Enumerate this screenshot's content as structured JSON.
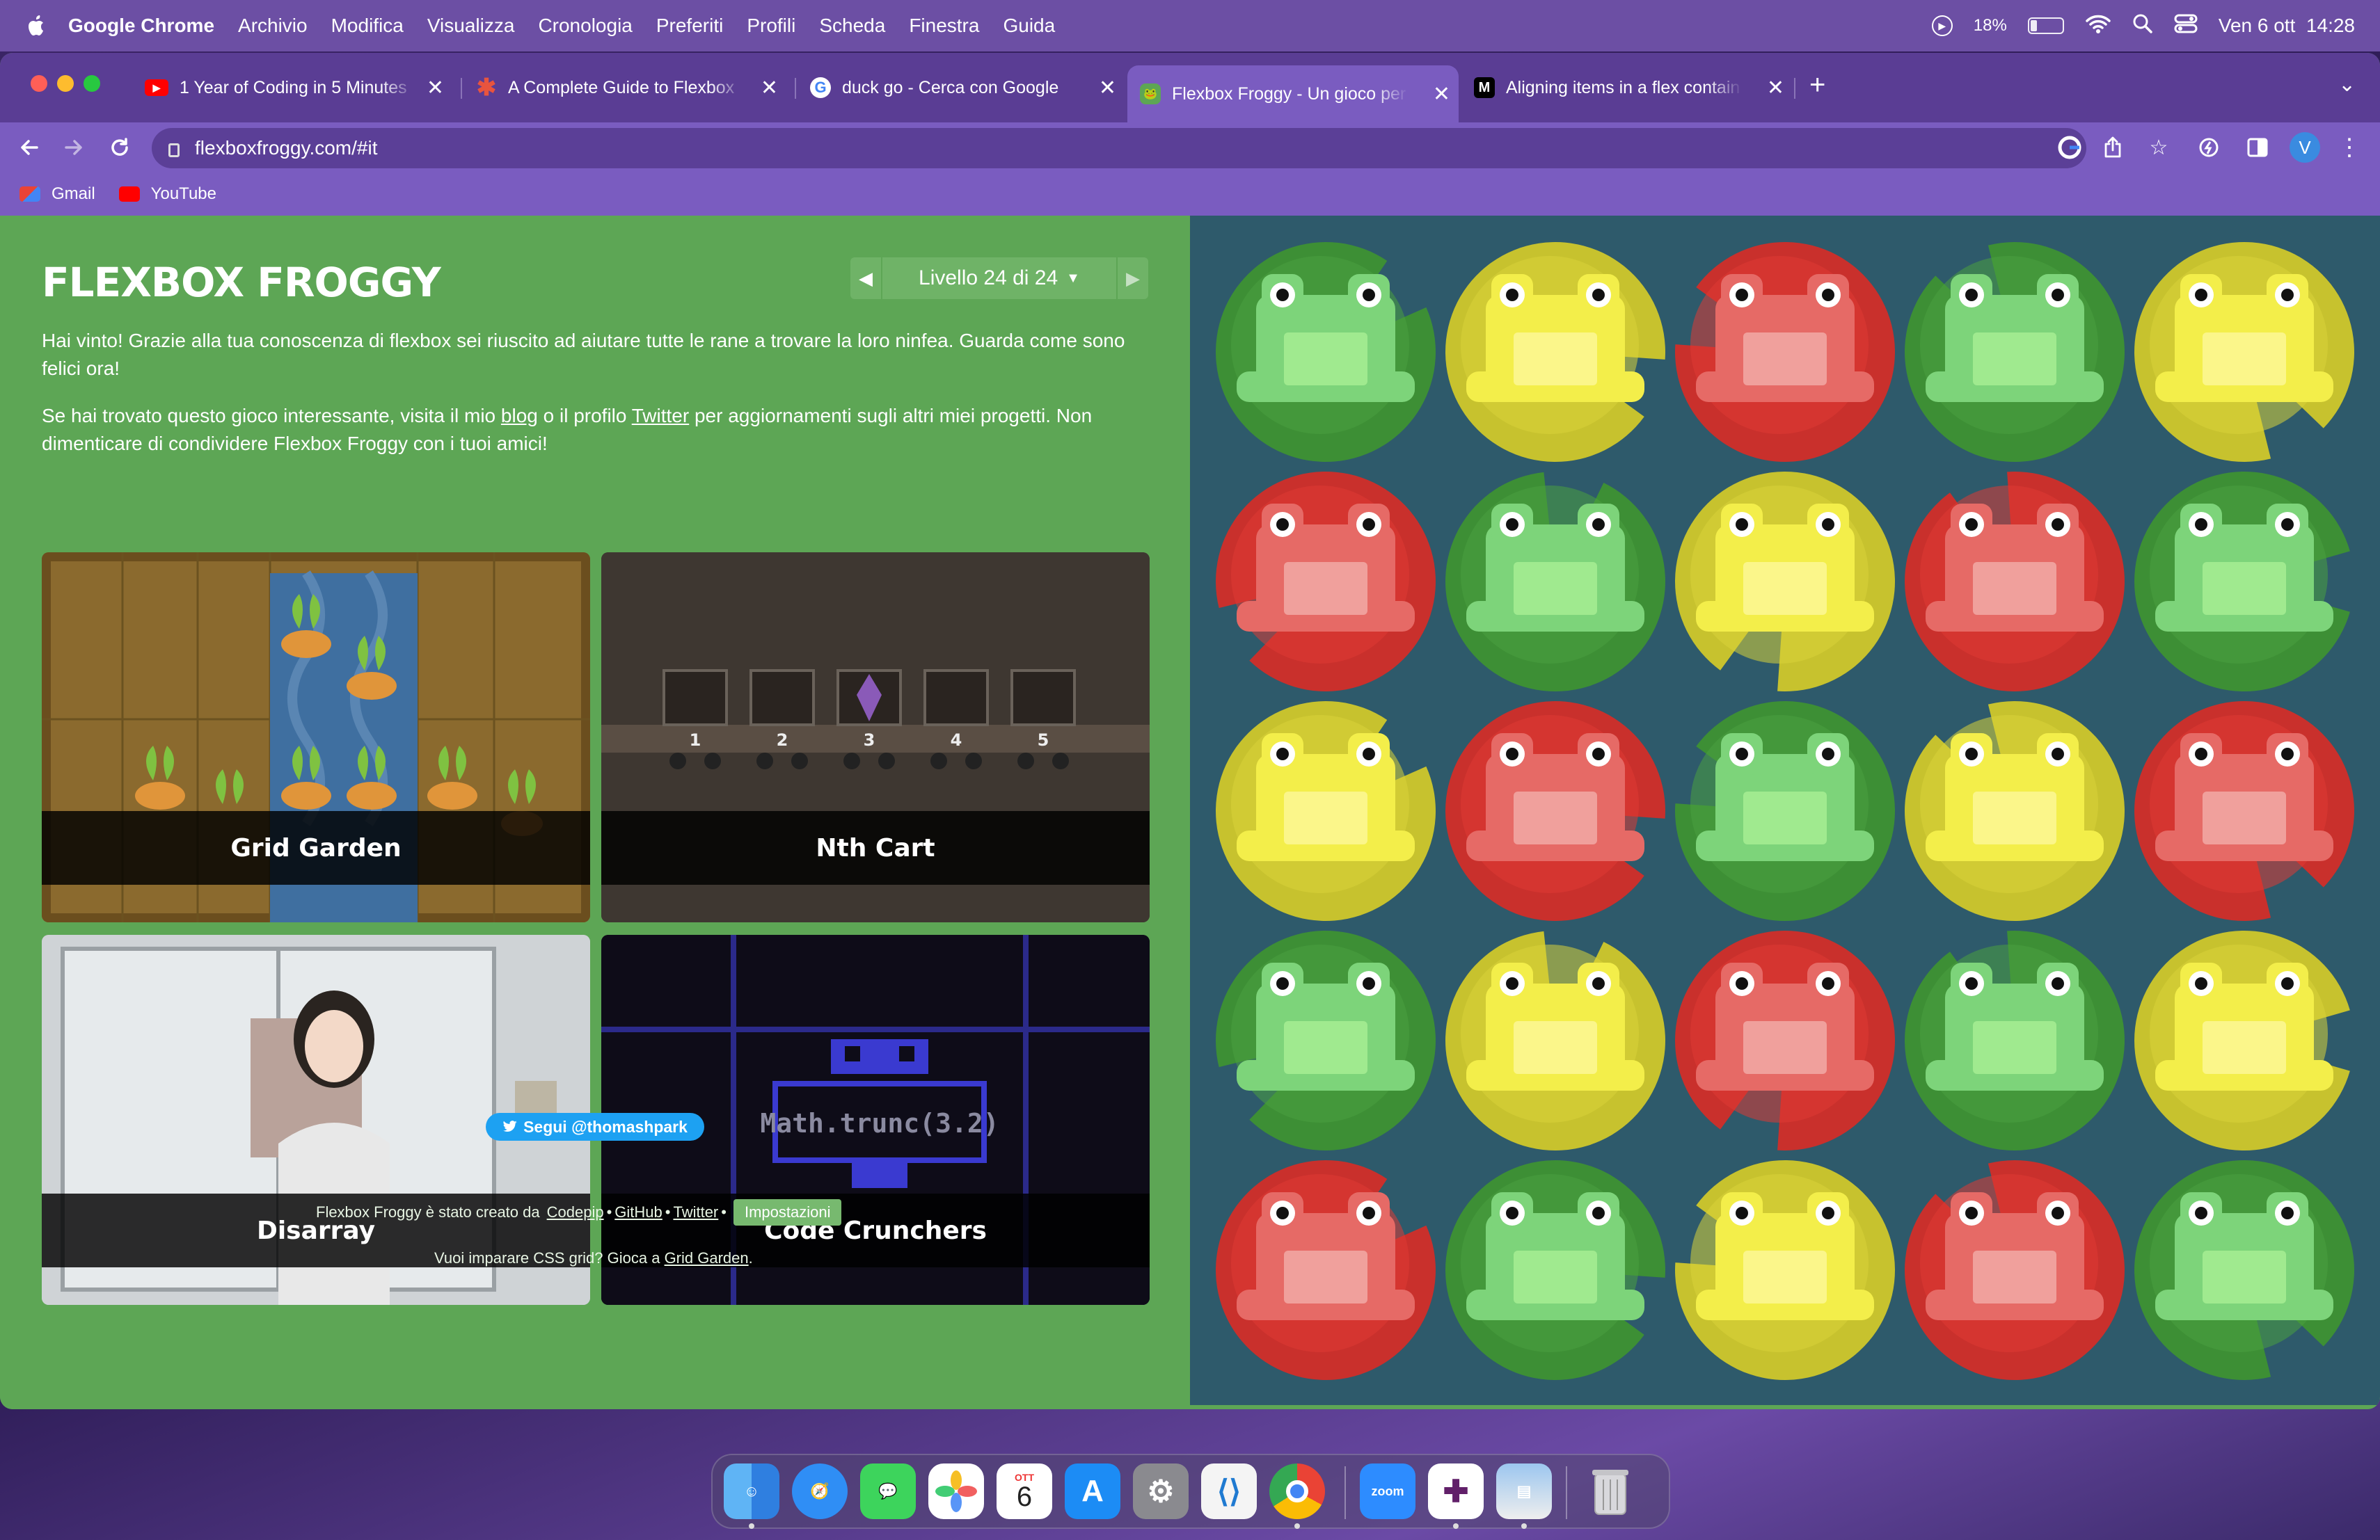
{
  "menubar": {
    "app": "Google Chrome",
    "items": [
      "Archivio",
      "Modifica",
      "Visualizza",
      "Cronologia",
      "Preferiti",
      "Profili",
      "Scheda",
      "Finestra",
      "Guida"
    ],
    "battery": "18%",
    "datetime": "Ven 6 ott  14:28"
  },
  "tabs": [
    {
      "title": "1 Year of Coding in 5 Minutes",
      "favicon_color": "#ff0000"
    },
    {
      "title": "A Complete Guide to Flexbox",
      "favicon_color": "#e8543e"
    },
    {
      "title": "duck go - Cerca con Google",
      "favicon_color": "#ffffff"
    },
    {
      "title": "Flexbox Froggy - Un gioco per",
      "favicon_color": "#5da655"
    },
    {
      "title": "Aligning items in a flex contain",
      "favicon_color": "#000000"
    }
  ],
  "url": "flexboxfroggy.com/#it",
  "avatar_letter": "V",
  "bookmarks": [
    {
      "label": "Gmail"
    },
    {
      "label": "YouTube"
    }
  ],
  "page": {
    "title": "FLEXBOX FROGGY",
    "level_label": "Livello 24 di 24",
    "win_text": "Hai vinto! Grazie alla tua conoscenza di flexbox sei riuscito ad aiutare tutte le rane a trovare la loro ninfea. Guarda come sono felici ora!",
    "promo": {
      "pre": "Se hai trovato questo gioco interessante, visita il mio ",
      "blog": "blog",
      "mid": " o il profilo ",
      "twitter": "Twitter",
      "post": " per aggiornamenti sugli altri miei progetti. Non dimenticare di condividere Flexbox Froggy con i tuoi amici!"
    },
    "games": [
      {
        "name": "Grid Garden"
      },
      {
        "name": "Nth Cart"
      },
      {
        "name": "Disarray"
      },
      {
        "name": "Code Crunchers"
      }
    ],
    "nth_cart_numbers": [
      "1",
      "2",
      "3",
      "4",
      "5"
    ],
    "code_crunchers_expr": "Math.trunc(3.2)",
    "follow_button": "Segui @thomashpark",
    "footer": {
      "created_by": "Flexbox Froggy è stato creato da",
      "codepip": "Codepip",
      "github": "GitHub",
      "twitter": "Twitter",
      "settings": "Impostazioni"
    },
    "footer2": {
      "pre": "Vuoi imparare CSS grid? Gioca a ",
      "link": "Grid Garden",
      "post": "."
    }
  },
  "board": {
    "rows": [
      [
        "green",
        "yellow",
        "red",
        "green",
        "yellow"
      ],
      [
        "red",
        "green",
        "yellow",
        "red",
        "green"
      ],
      [
        "yellow",
        "red",
        "green",
        "yellow",
        "red"
      ],
      [
        "green",
        "yellow",
        "red",
        "green",
        "yellow"
      ],
      [
        "red",
        "green",
        "yellow",
        "red",
        "green"
      ]
    ],
    "colors": {
      "green": {
        "pad": "#3d8f35",
        "padlight": "#4aa13f",
        "frog": "#7dd47a",
        "belly": "#a0ea8f"
      },
      "yellow": {
        "pad": "#c7c22e",
        "padlight": "#d9d43a",
        "frog": "#f3ee4a",
        "belly": "#fbf68a"
      },
      "red": {
        "pad": "#c9302c",
        "padlight": "#de3a34",
        "frog": "#e66a66",
        "belly": "#f0a09c"
      }
    }
  },
  "dock": {
    "calendar_month": "OTT",
    "calendar_day": "6",
    "zoom": "zoom"
  }
}
